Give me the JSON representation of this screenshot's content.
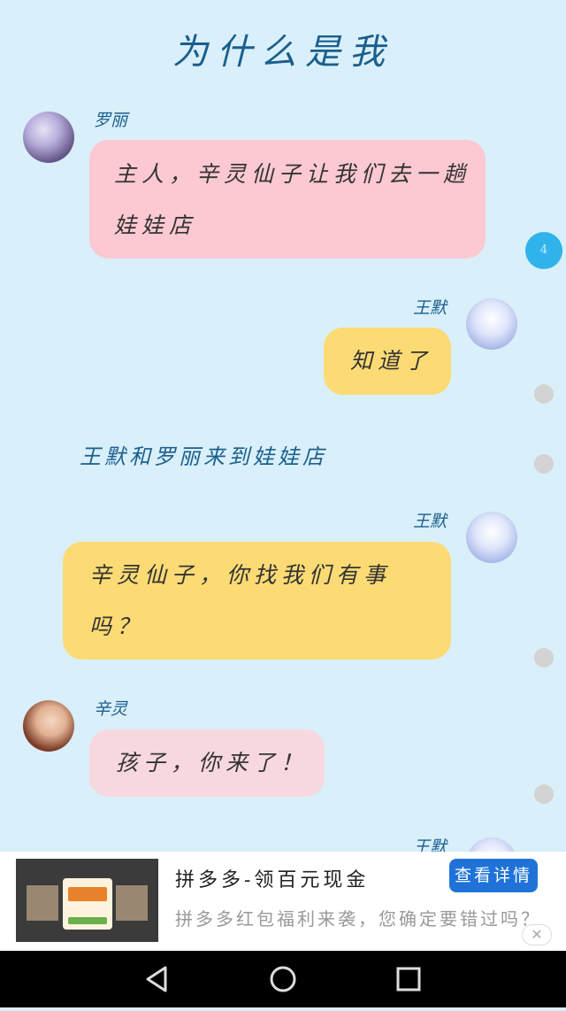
{
  "header": {
    "title": "为什么是我"
  },
  "messages": [
    {
      "speaker": "罗丽",
      "text_line1": "主人，辛灵仙子让我们去一趟",
      "text_line2": "娃娃店",
      "bubble_color": "#fcc9d3"
    },
    {
      "speaker": "王默",
      "text": "知道了",
      "bubble_color": "#fcdb75"
    },
    {
      "narration": "王默和罗丽来到娃娃店"
    },
    {
      "speaker": "王默",
      "text_line1": "辛灵仙子，你找我们有事",
      "text_line2": "吗？",
      "bubble_color": "#fcdb75"
    },
    {
      "speaker": "辛灵",
      "text": "孩子，你来了！",
      "bubble_color": "#f7d8de"
    },
    {
      "speaker": "王默"
    }
  ],
  "side_badge": {
    "count": "4",
    "color": "#2fb3ea"
  },
  "ad": {
    "title": "拼多多-领百元现金",
    "description": "拼多多红包福利来袭，您确定要错过吗？",
    "button_label": "查看详情",
    "close_icon": "close-icon",
    "button_color": "#1f73d8"
  },
  "navbar": {
    "icons": [
      "back-icon",
      "home-icon",
      "recent-apps-icon"
    ]
  }
}
